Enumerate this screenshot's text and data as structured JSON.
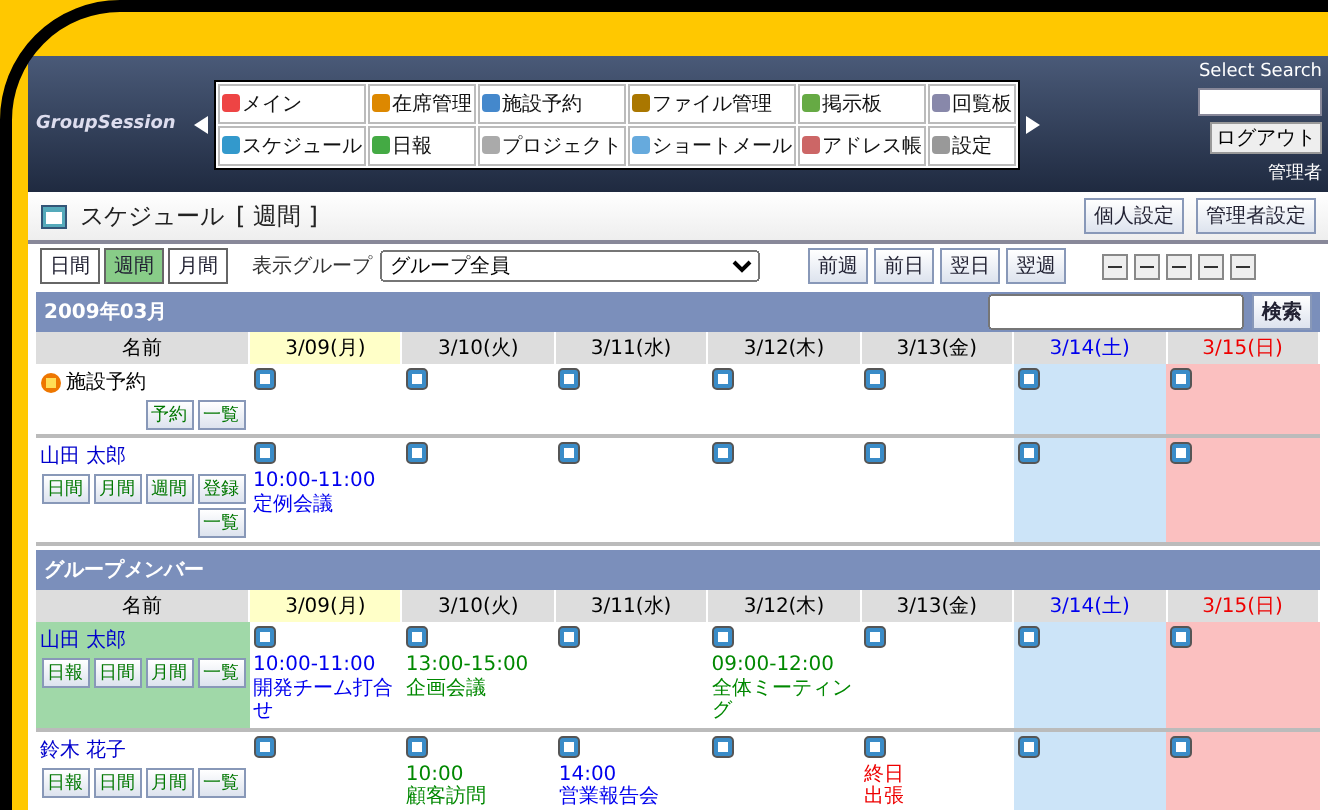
{
  "header": {
    "logo": "GroupSession",
    "menu": [
      {
        "label": "メイン"
      },
      {
        "label": "在席管理"
      },
      {
        "label": "施設予約"
      },
      {
        "label": "ファイル管理"
      },
      {
        "label": "掲示板"
      },
      {
        "label": "回覧板"
      },
      {
        "label": "スケジュール"
      },
      {
        "label": "日報"
      },
      {
        "label": "プロジェクト"
      },
      {
        "label": "ショートメール"
      },
      {
        "label": "アドレス帳"
      },
      {
        "label": "設定"
      }
    ],
    "search_label": "Select Search",
    "logout": "ログアウト",
    "user": "管理者"
  },
  "title": {
    "label": "スケジュール",
    "view": "[ 週間 ]",
    "buttons": [
      "個人設定",
      "管理者設定"
    ]
  },
  "toolbar": {
    "view_tabs": [
      {
        "label": "日間",
        "selected": false
      },
      {
        "label": "週間",
        "selected": true
      },
      {
        "label": "月間",
        "selected": false
      }
    ],
    "group_label": "表示グループ",
    "group_value": "グループ全員",
    "nav_buttons": [
      "前週",
      "前日",
      "翌日",
      "翌週"
    ]
  },
  "sections": [
    {
      "title": "2009年03月",
      "search_button": "検索",
      "name_header": "名前",
      "days": [
        {
          "label": "3/09(月)",
          "kind": "weekday",
          "today": true
        },
        {
          "label": "3/10(火)",
          "kind": "weekday",
          "today": false
        },
        {
          "label": "3/11(水)",
          "kind": "weekday",
          "today": false
        },
        {
          "label": "3/12(木)",
          "kind": "weekday",
          "today": false
        },
        {
          "label": "3/13(金)",
          "kind": "weekday",
          "today": false
        },
        {
          "label": "3/14(土)",
          "kind": "saturday",
          "today": false
        },
        {
          "label": "3/15(日)",
          "kind": "sunday",
          "today": false
        }
      ],
      "rows": [
        {
          "name": "施設予約",
          "kind": "facility",
          "selected": false,
          "links": [
            "予約",
            "一覧"
          ],
          "cells": [
            [],
            [],
            [],
            [],
            [],
            [],
            []
          ]
        },
        {
          "name": "山田 太郎",
          "kind": "user",
          "selected": false,
          "links": [
            "日間",
            "月間",
            "週間",
            "登録",
            "一覧"
          ],
          "cells": [
            [
              {
                "text": "10:00-11:00 定例会議",
                "color": "#0000ee"
              }
            ],
            [],
            [],
            [],
            [],
            [],
            []
          ]
        }
      ]
    },
    {
      "title": "グループメンバー",
      "name_header": "名前",
      "days": [
        {
          "label": "3/09(月)",
          "kind": "weekday",
          "today": true
        },
        {
          "label": "3/10(火)",
          "kind": "weekday",
          "today": false
        },
        {
          "label": "3/11(水)",
          "kind": "weekday",
          "today": false
        },
        {
          "label": "3/12(木)",
          "kind": "weekday",
          "today": false
        },
        {
          "label": "3/13(金)",
          "kind": "weekday",
          "today": false
        },
        {
          "label": "3/14(土)",
          "kind": "saturday",
          "today": false
        },
        {
          "label": "3/15(日)",
          "kind": "sunday",
          "today": false
        }
      ],
      "rows": [
        {
          "name": "山田 太郎",
          "kind": "user",
          "selected": true,
          "links": [
            "日報",
            "日間",
            "月間",
            "一覧"
          ],
          "cells": [
            [
              {
                "text": "10:00-11:00",
                "color": "#0000ee"
              },
              {
                "text": "開発チーム打合せ",
                "color": "#0000ee"
              }
            ],
            [
              {
                "text": "13:00-15:00",
                "color": "#008800"
              },
              {
                "text": "企画会議",
                "color": "#008800"
              }
            ],
            [],
            [
              {
                "text": "09:00-12:00",
                "color": "#008800"
              },
              {
                "text": "全体ミーティング",
                "color": "#008800"
              }
            ],
            [],
            [],
            []
          ]
        },
        {
          "name": "鈴木 花子",
          "kind": "user",
          "selected": false,
          "links": [
            "日報",
            "日間",
            "月間",
            "一覧"
          ],
          "cells": [
            [],
            [
              {
                "text": "10:00",
                "color": "#008800"
              },
              {
                "text": "顧客訪問",
                "color": "#008800"
              }
            ],
            [
              {
                "text": "14:00",
                "color": "#0000ee"
              },
              {
                "text": "営業報告会",
                "color": "#0000ee"
              }
            ],
            [],
            [
              {
                "text": "終日",
                "color": "#ee0000"
              },
              {
                "text": "出張",
                "color": "#ee0000"
              }
            ],
            [],
            []
          ]
        }
      ]
    }
  ]
}
